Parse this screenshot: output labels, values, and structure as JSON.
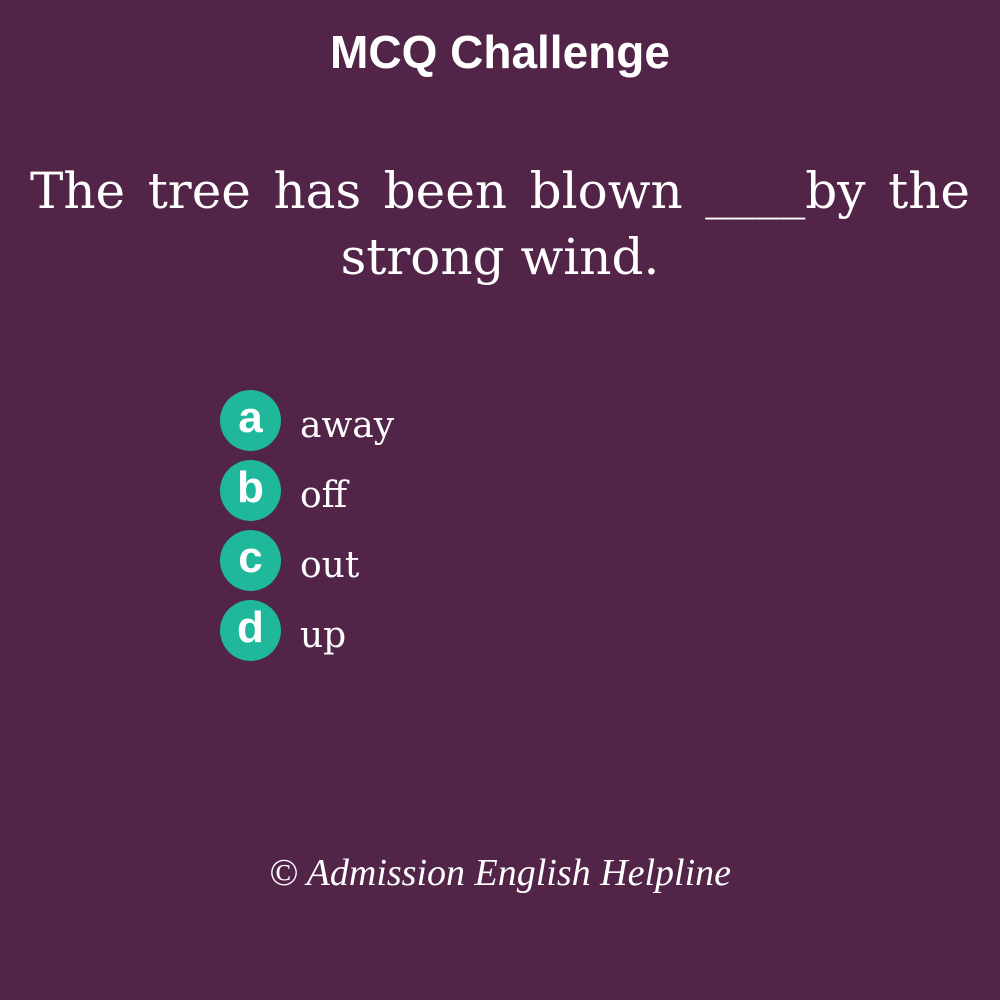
{
  "header": {
    "title": "MCQ Challenge"
  },
  "question": {
    "text": "The tree has been blown ____by the strong wind."
  },
  "options": [
    {
      "letter": "a",
      "text": "away"
    },
    {
      "letter": "b",
      "text": "off"
    },
    {
      "letter": "c",
      "text": "out"
    },
    {
      "letter": "d",
      "text": "up"
    }
  ],
  "footer": {
    "copyright": "© Admission English Helpline"
  },
  "colors": {
    "background": "#522448",
    "accent": "#1fb89a",
    "text": "#ffffff"
  }
}
